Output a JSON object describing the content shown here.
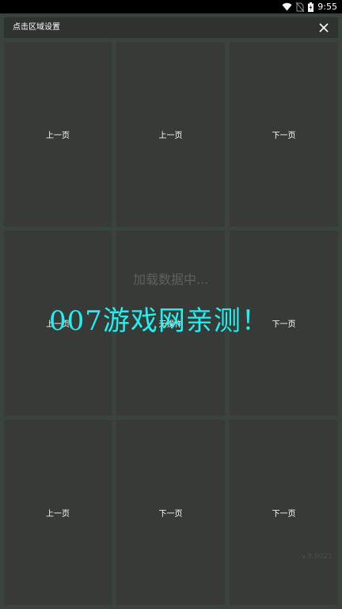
{
  "status_bar": {
    "time": "9:55",
    "icons": [
      "wifi-icon",
      "no-sim-icon",
      "battery-charging-icon"
    ]
  },
  "header": {
    "title": "点击区域设置",
    "close_icon": "close-icon"
  },
  "grid": {
    "cells": [
      {
        "label": "上一页"
      },
      {
        "label": "上一页"
      },
      {
        "label": "下一页"
      },
      {
        "label": "上一页"
      },
      {
        "label": "无操作"
      },
      {
        "label": "下一页"
      },
      {
        "label": "上一页"
      },
      {
        "label": "下一页"
      },
      {
        "label": "下一页"
      }
    ]
  },
  "overlay": {
    "loading": "加载数据中...",
    "watermark": "007游戏网亲测！",
    "faint_mark": "v.9.0021"
  },
  "colors": {
    "background": "#3b443c",
    "cell": "#383a38",
    "header": "#2f3330",
    "watermark": "#22f0f0"
  }
}
